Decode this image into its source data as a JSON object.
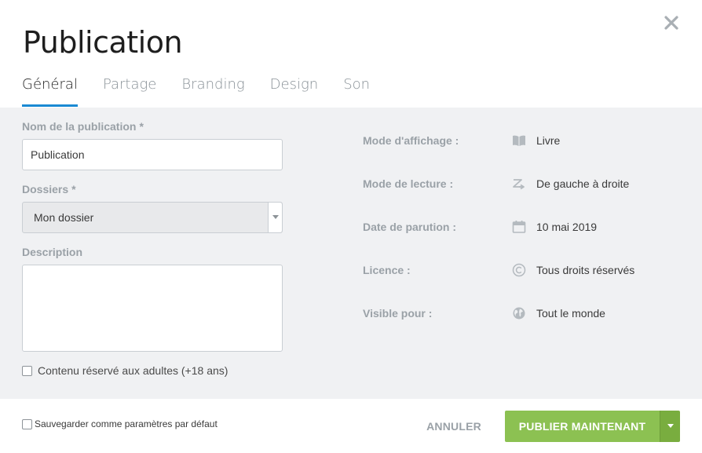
{
  "dialog": {
    "title": "Publication",
    "tabs": [
      {
        "label": "Général",
        "active": true
      },
      {
        "label": "Partage",
        "active": false
      },
      {
        "label": "Branding",
        "active": false
      },
      {
        "label": "Design",
        "active": false
      },
      {
        "label": "Son",
        "active": false
      }
    ]
  },
  "form": {
    "name_label": "Nom de la publication",
    "name_required": "*",
    "name_value": "Publication",
    "folders_label": "Dossiers",
    "folders_required": "*",
    "folders_value": "Mon dossier",
    "description_label": "Description",
    "description_value": "",
    "adult_label": "Contenu réservé aux adultes (+18 ans)",
    "adult_checked": false
  },
  "info": [
    {
      "label": "Mode d'affichage :",
      "icon": "book-icon",
      "value": "Livre"
    },
    {
      "label": "Mode de lecture :",
      "icon": "reading-direction-icon",
      "value": "De gauche à droite"
    },
    {
      "label": "Date de parution :",
      "icon": "calendar-icon",
      "value": "10 mai 2019"
    },
    {
      "label": "Licence :",
      "icon": "copyright-icon",
      "value": "Tous droits réservés"
    },
    {
      "label": "Visible pour :",
      "icon": "globe-icon",
      "value": "Tout le monde"
    }
  ],
  "footer": {
    "default_label": "Sauvegarder comme paramètres par défaut",
    "default_checked": false,
    "cancel_label": "ANNULER",
    "publish_label": "PUBLIER MAINTENANT"
  },
  "colors": {
    "accent": "#1b8ad3",
    "publish": "#8cc152",
    "panel_bg": "#f0f1f3"
  }
}
